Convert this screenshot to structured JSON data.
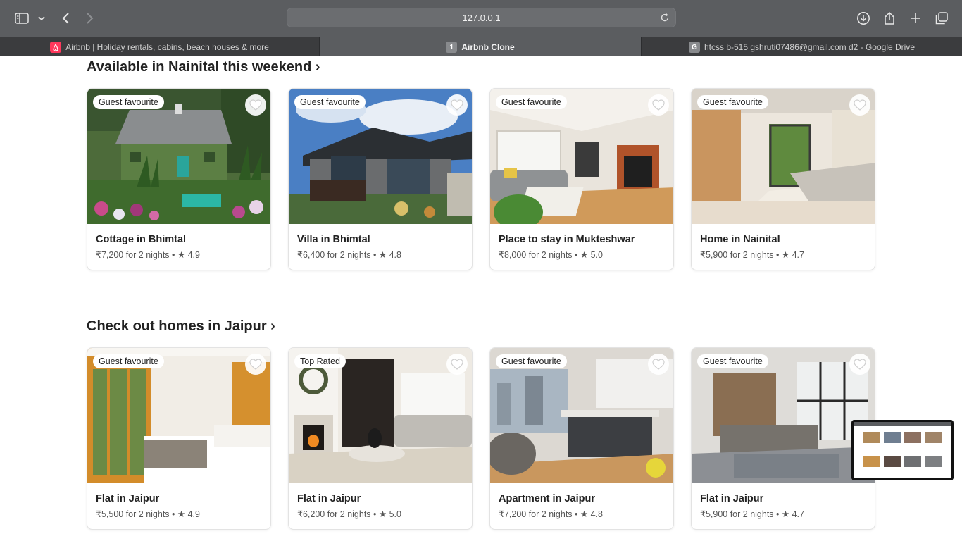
{
  "browser": {
    "url": "127.0.0.1",
    "tabs": [
      {
        "label": "Airbnb | Holiday rentals, cabins, beach houses & more",
        "icon": "airbnb-logo-icon",
        "icon_color": "#ff385c"
      },
      {
        "label": "Airbnb Clone",
        "icon_text": "1",
        "icon_color": "#888a8d"
      },
      {
        "label": "htcss b-515 gshruti07486@gmail.com d2 - Google Drive",
        "icon_text": "G",
        "icon_color": "#888a8d"
      }
    ]
  },
  "sections": [
    {
      "title": "Available in Nainital this weekend ›",
      "cards": [
        {
          "badge": "Guest favourite",
          "title": "Cottage in Bhimtal",
          "price": "₹7,200 for 2 nights",
          "rating": "4.9"
        },
        {
          "badge": "Guest favourite",
          "title": "Villa in Bhimtal",
          "price": "₹6,400 for 2 nights",
          "rating": "4.8"
        },
        {
          "badge": "Guest favourite",
          "title": "Place to stay in Mukteshwar",
          "price": "₹8,000 for 2 nights",
          "rating": "5.0"
        },
        {
          "badge": "Guest favourite",
          "title": "Home in Nainital",
          "price": "₹5,900 for 2 nights",
          "rating": "4.7"
        }
      ]
    },
    {
      "title": "Check out homes in Jaipur ›",
      "cards": [
        {
          "badge": "Guest favourite",
          "title": "Flat in Jaipur",
          "price": "₹5,500 for 2 nights",
          "rating": "4.9"
        },
        {
          "badge": "Top Rated",
          "title": "Flat in Jaipur",
          "price": "₹6,200 for 2 nights",
          "rating": "5.0"
        },
        {
          "badge": "Guest favourite",
          "title": "Apartment in Jaipur",
          "price": "₹7,200 for 2 nights",
          "rating": "4.8"
        },
        {
          "badge": "Guest favourite",
          "title": "Flat in Jaipur",
          "price": "₹5,900 for 2 nights",
          "rating": "4.7"
        }
      ]
    }
  ],
  "separator": " • ",
  "star": "★"
}
